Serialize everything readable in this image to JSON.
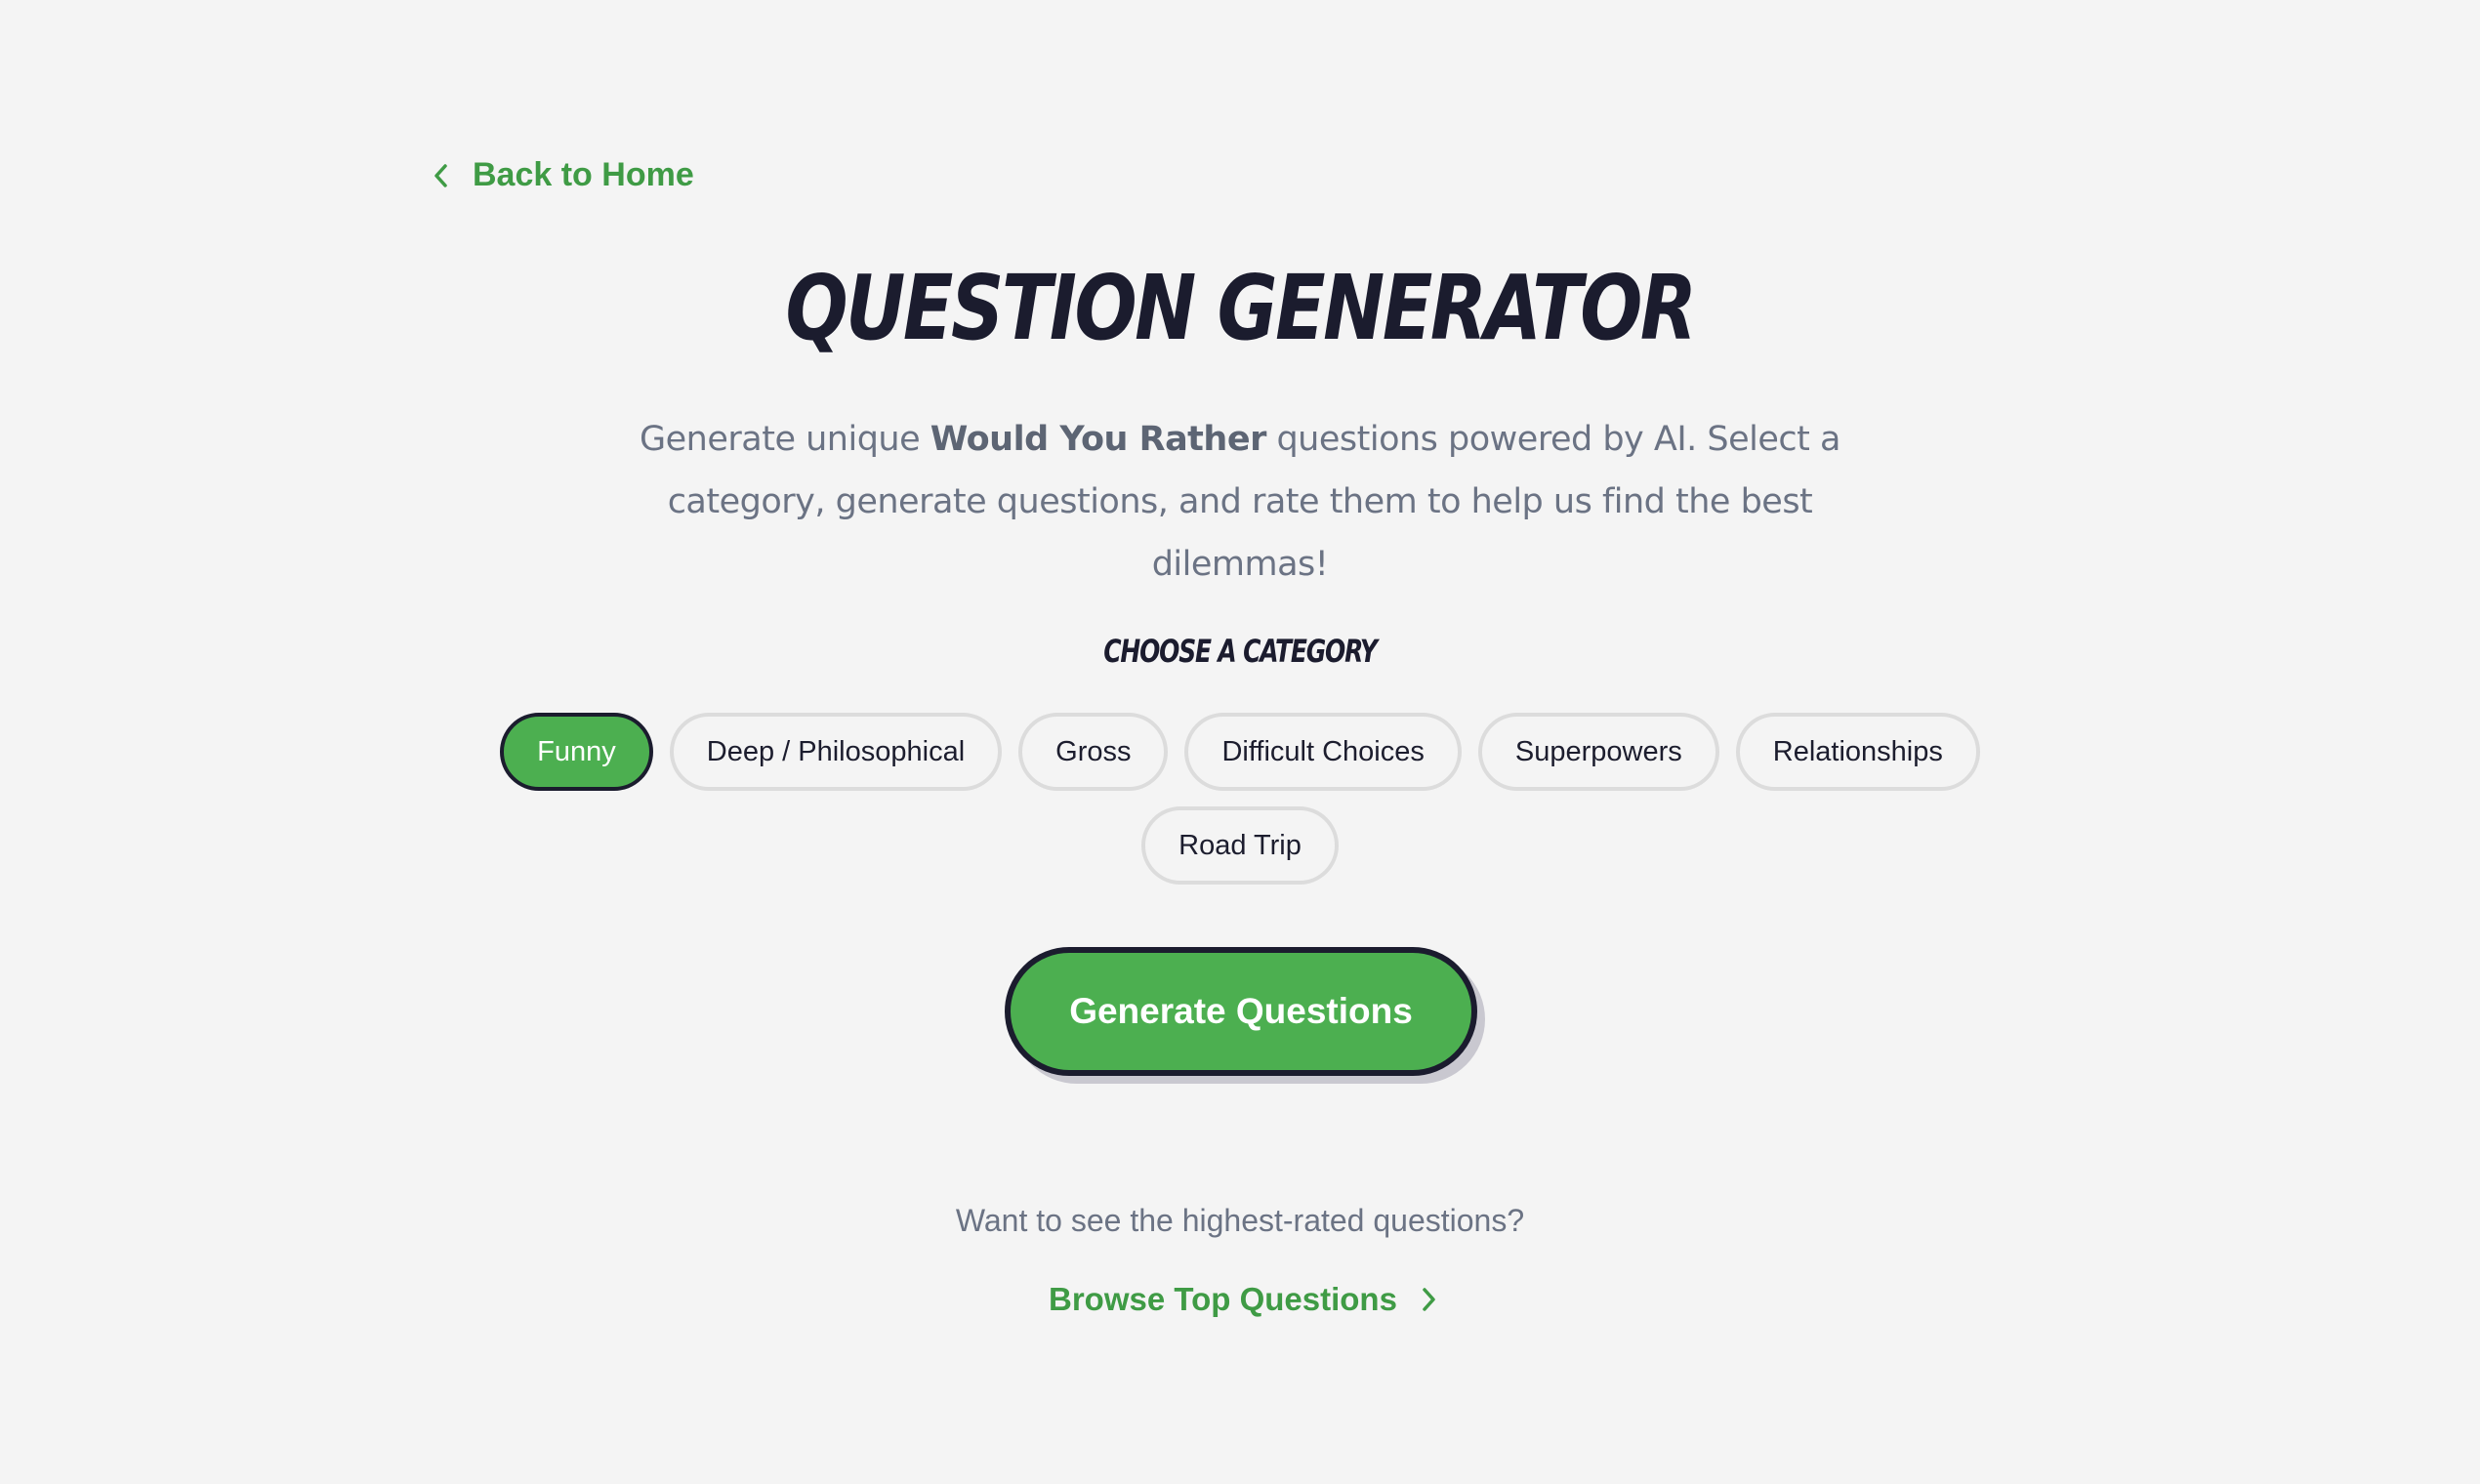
{
  "nav": {
    "back_label": "Back to Home"
  },
  "header": {
    "title": "QUESTION GENERATOR",
    "subtitle_before": "Generate unique ",
    "subtitle_bold": "Would You Rather",
    "subtitle_after": " questions powered by AI. Select a category, generate questions, and rate them to help us find the best dilemmas!"
  },
  "categories": {
    "label": "Choose a Category",
    "items": [
      {
        "label": "Funny",
        "selected": true
      },
      {
        "label": "Deep / Philosophical",
        "selected": false
      },
      {
        "label": "Gross",
        "selected": false
      },
      {
        "label": "Difficult Choices",
        "selected": false
      },
      {
        "label": "Superpowers",
        "selected": false
      },
      {
        "label": "Relationships",
        "selected": false
      },
      {
        "label": "Road Trip",
        "selected": false
      }
    ]
  },
  "actions": {
    "generate_label": "Generate Questions"
  },
  "footer": {
    "prompt": "Want to see the highest-rated questions?",
    "browse_label": "Browse Top Questions"
  },
  "colors": {
    "accent": "#4caf50",
    "link": "#3f9b45",
    "ink": "#1b1c2e",
    "muted": "#6b7384",
    "background": "#f4f4f4"
  },
  "icons": {
    "back": "chevron-left-icon",
    "browse": "chevron-right-icon"
  }
}
